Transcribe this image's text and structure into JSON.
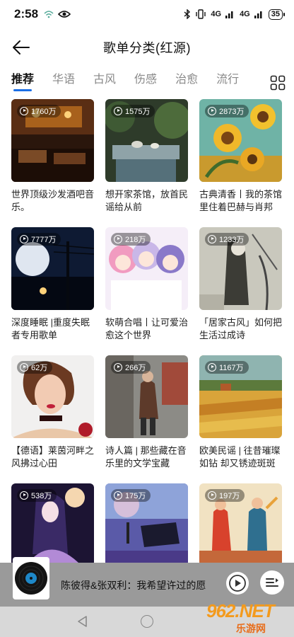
{
  "status": {
    "time": "2:58",
    "net1": "4G",
    "net2": "4G",
    "battery": "35"
  },
  "header": {
    "title": "歌单分类(红源)"
  },
  "tabs": [
    {
      "label": "推荐",
      "active": true
    },
    {
      "label": "华语",
      "active": false
    },
    {
      "label": "古风",
      "active": false
    },
    {
      "label": "伤感",
      "active": false
    },
    {
      "label": "治愈",
      "active": false
    },
    {
      "label": "流行",
      "active": false
    }
  ],
  "playlists": [
    {
      "count": "1760万",
      "title": "世界顶级沙发酒吧音乐。",
      "cover": "bar"
    },
    {
      "count": "1575万",
      "title": "想开家茶馆，放首民谣给从前",
      "cover": "teahouse"
    },
    {
      "count": "2873万",
      "title": "古典清香丨我的茶馆里住着巴赫与肖邦",
      "cover": "sunflower"
    },
    {
      "count": "7777万",
      "title": "深度睡眠 |重度失眠者专用歌单",
      "cover": "night"
    },
    {
      "count": "218万",
      "title": "软萌合唱丨让可爱治愈这个世界",
      "cover": "anime"
    },
    {
      "count": "1233万",
      "title": "「居家古风」如何把生活过成诗",
      "cover": "ink"
    },
    {
      "count": "62万",
      "title": "【德语】莱茵河畔之风拂过心田",
      "cover": "portrait"
    },
    {
      "count": "266万",
      "title": "诗人篇 | 那些藏在音乐里的文学宝藏",
      "cover": "street"
    },
    {
      "count": "1167万",
      "title": "欧美民谣 | 往昔璀璨如钻 却又锈迹斑斑",
      "cover": "field"
    },
    {
      "count": "538万",
      "title": "",
      "cover": "purplegirl"
    },
    {
      "count": "175万",
      "title": "",
      "cover": "piano"
    },
    {
      "count": "197万",
      "title": "",
      "cover": "dancers"
    }
  ],
  "player": {
    "song": "陈彼得&张双利：我希望许过的愿"
  },
  "watermark": {
    "big": "962.NET",
    "small": "乐游网"
  },
  "colors": {
    "accent": "#1b6fe6",
    "player_bg": "#9a9a9a",
    "navbar_bg": "#d8d8d8"
  }
}
